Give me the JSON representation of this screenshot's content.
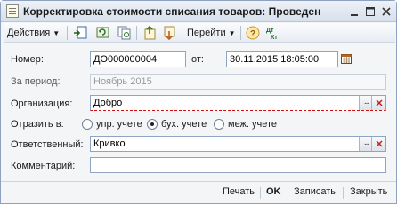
{
  "window": {
    "title": "Корректировка стоимости списания товаров: Проведен",
    "icon": "document-icon",
    "controls": [
      "minimize",
      "maximize",
      "close"
    ]
  },
  "toolbar": {
    "actions_label": "Действия",
    "goto_label": "Перейти",
    "icons": [
      "post-document-icon",
      "refresh-icon",
      "copy-icon",
      "move-up-icon",
      "move-down-icon",
      "help-icon",
      "dt-kt-icon"
    ],
    "dt_kt_text": "Дт\nКт"
  },
  "form": {
    "number_label": "Номер:",
    "number_value": "ДО000000004",
    "date_label": "от:",
    "date_value": "30.11.2015 18:05:00",
    "period_label": "За период:",
    "period_value": "Ноябрь 2015",
    "org_label": "Организация:",
    "org_value": "Добро",
    "reflect_label": "Отразить в:",
    "reflect_options": [
      {
        "label": "упр. учете",
        "checked": false
      },
      {
        "label": "бух. учете",
        "checked": true
      },
      {
        "label": "меж. учете",
        "checked": false
      }
    ],
    "responsible_label": "Ответственный:",
    "responsible_value": "Кривко",
    "comment_label": "Комментарий:",
    "comment_value": "",
    "select_button": "..."
  },
  "bottom": {
    "print_label": "Печать",
    "ok_label": "OK",
    "save_label": "Записать",
    "close_label": "Закрыть"
  },
  "colors": {
    "title_bg": "#d6dfeb",
    "field_border": "#8fa4c2",
    "required_underline": "#d01010"
  }
}
